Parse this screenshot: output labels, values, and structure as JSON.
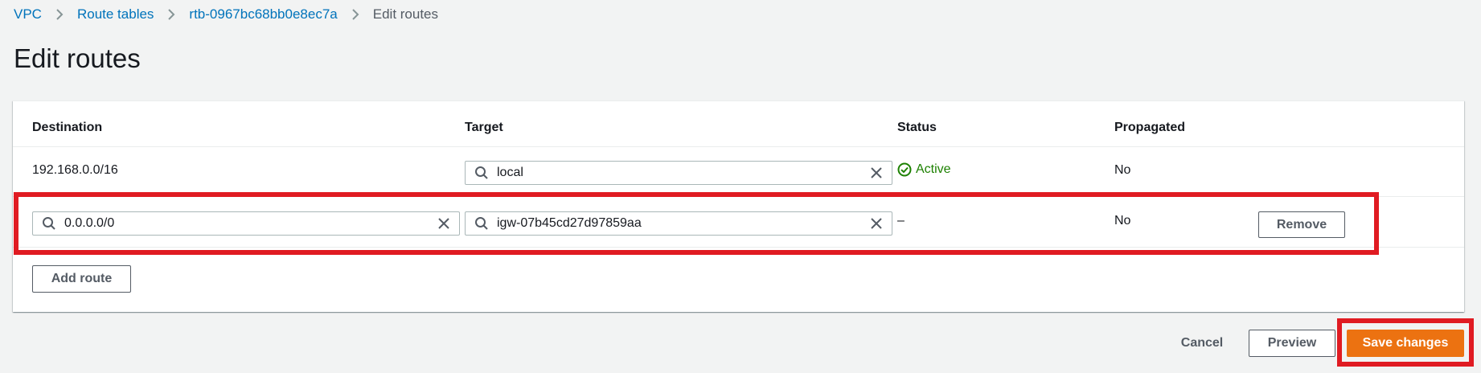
{
  "breadcrumb": {
    "items": [
      {
        "label": "VPC"
      },
      {
        "label": "Route tables"
      },
      {
        "label": "rtb-0967bc68bb0e8ec7a"
      },
      {
        "label": "Edit routes"
      }
    ]
  },
  "page": {
    "title": "Edit routes"
  },
  "table": {
    "headers": {
      "destination": "Destination",
      "target": "Target",
      "status": "Status",
      "propagated": "Propagated"
    },
    "rows": [
      {
        "destination": "192.168.0.0/16",
        "target": "local",
        "status": "Active",
        "propagated": "No"
      },
      {
        "destination": "0.0.0.0/0",
        "target": "igw-07b45cd27d97859aa",
        "status": "–",
        "propagated": "No",
        "remove_label": "Remove"
      }
    ],
    "add_route_label": "Add route"
  },
  "footer": {
    "cancel_label": "Cancel",
    "preview_label": "Preview",
    "save_label": "Save changes"
  },
  "colors": {
    "link": "#0073bb",
    "primary": "#ec7211",
    "success": "#1d8102",
    "highlight": "#e01b22"
  }
}
